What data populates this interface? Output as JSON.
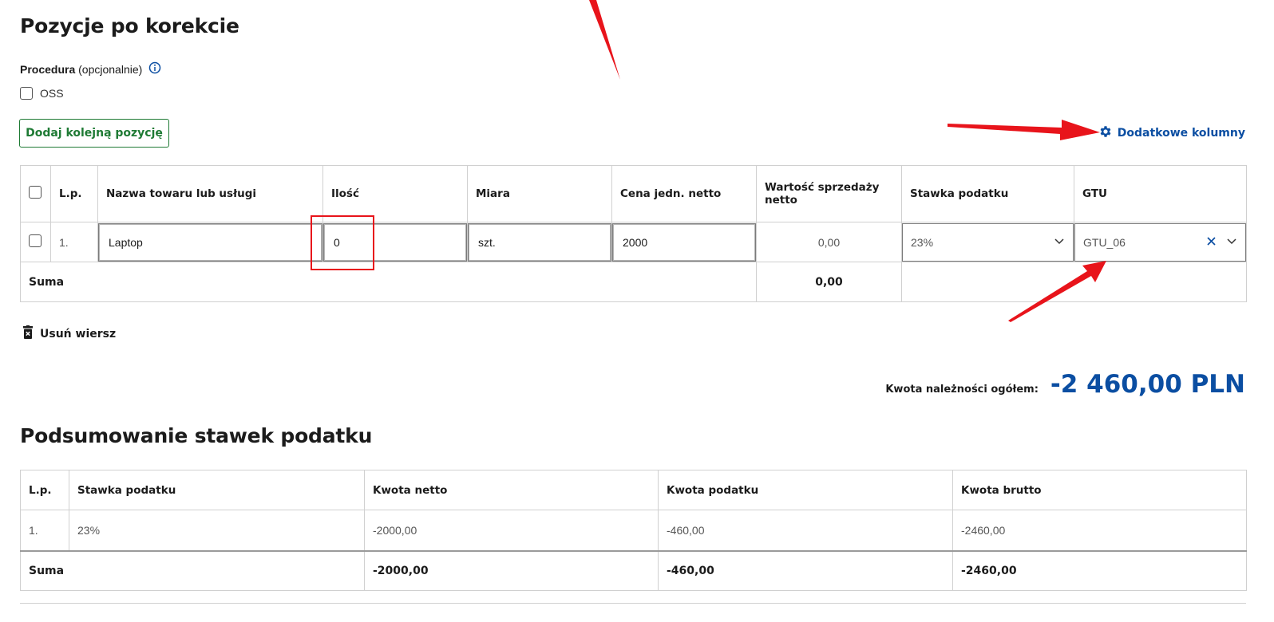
{
  "section1_title": "Pozycje po korekcie",
  "procedure": {
    "label": "Procedura",
    "optional": "(opcjonalnie)",
    "oss_label": "OSS"
  },
  "add_button": "Dodaj kolejną pozycję",
  "extra_columns_link": "Dodatkowe kolumny",
  "items_table": {
    "headers": [
      "L.p.",
      "Nazwa towaru lub usługi",
      "Ilość",
      "Miara",
      "Cena jedn. netto",
      "Wartość sprzedaży netto",
      "Stawka podatku",
      "GTU"
    ],
    "row": {
      "lp": "1.",
      "name": "Laptop",
      "qty": "0",
      "unit": "szt.",
      "price": "2000",
      "net_value": "0,00",
      "tax_rate": "23%",
      "gtu": "GTU_06"
    },
    "sum_label": "Suma",
    "sum_value": "0,00"
  },
  "delete_row": "Usuń wiersz",
  "total": {
    "label": "Kwota należności ogółem:",
    "value": "-2 460,00 PLN"
  },
  "section2_title": "Podsumowanie stawek podatku",
  "summary_table": {
    "headers": [
      "L.p.",
      "Stawka podatku",
      "Kwota netto",
      "Kwota podatku",
      "Kwota brutto"
    ],
    "row": {
      "lp": "1.",
      "rate": "23%",
      "net": "-2000,00",
      "tax": "-460,00",
      "gross": "-2460,00"
    },
    "sum": {
      "label": "Suma",
      "net": "-2000,00",
      "tax": "-460,00",
      "gross": "-2460,00"
    }
  },
  "icons": {
    "info": "info-circle-icon",
    "gear": "gear-icon",
    "trash": "trash-icon",
    "chevron": "chevron-down-icon",
    "clear": "close-icon"
  },
  "colors": {
    "link": "#0b4ea2",
    "button_green": "#1e7a34",
    "annotation_red": "#e8141b"
  }
}
